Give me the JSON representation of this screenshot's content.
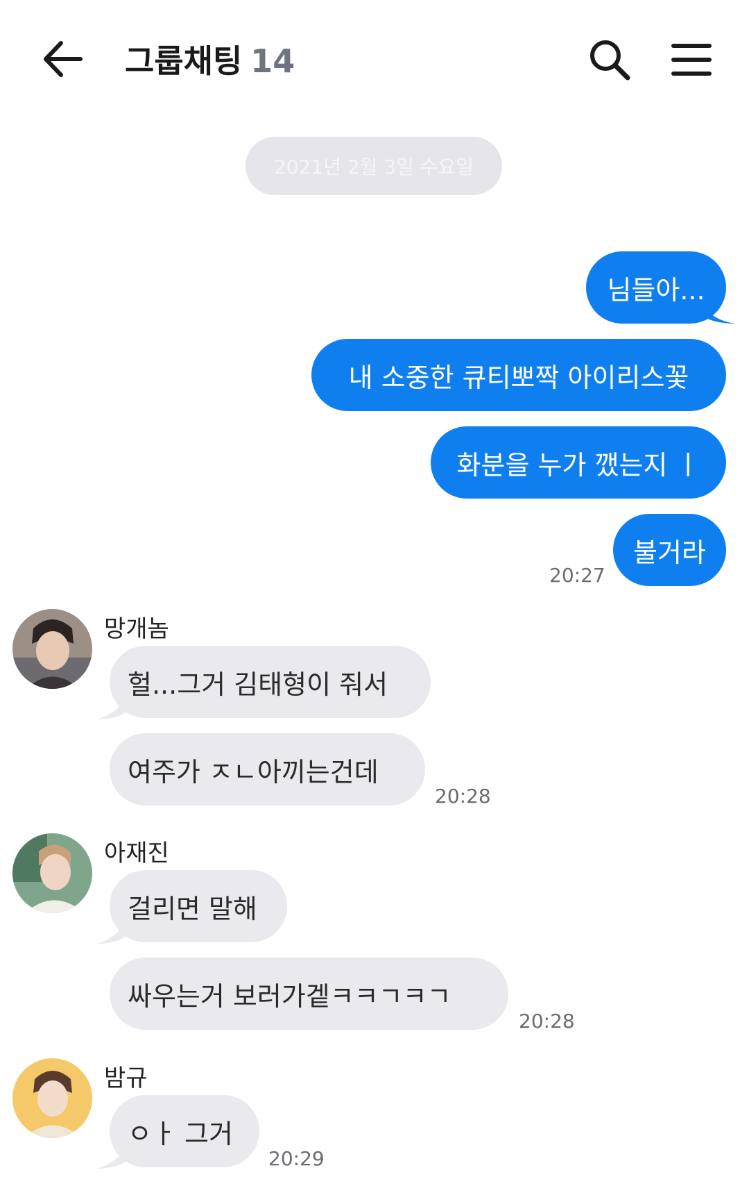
{
  "header": {
    "title": "그룹채팅",
    "member_count": "14"
  },
  "date_divider": "2021년 2월 3일 수요일",
  "outgoing": {
    "messages": [
      "님들아...",
      "내 소중한 큐티뽀짝 아이리스꽃",
      "화분을 누가 깼는지 ㅣ",
      "불거라"
    ],
    "time": "20:27"
  },
  "groups": [
    {
      "sender": "망개놈",
      "messages": [
        "헐...그거 김태형이 줘서",
        "여주가 ㅈㄴ아끼는건데"
      ],
      "time": "20:28"
    },
    {
      "sender": "아재진",
      "messages": [
        "걸리면 말해",
        "싸우는거 보러가겥ㅋㅋㄱㅋㄱ"
      ],
      "time": "20:28"
    },
    {
      "sender": "밤규",
      "messages": [
        "ㅇㅏ 그거"
      ],
      "time": "20:29"
    }
  ],
  "colors": {
    "outgoing_bubble": "#0f7ff0",
    "incoming_bubble": "#e9e9ee",
    "date_pill": "#e6e6ea"
  }
}
